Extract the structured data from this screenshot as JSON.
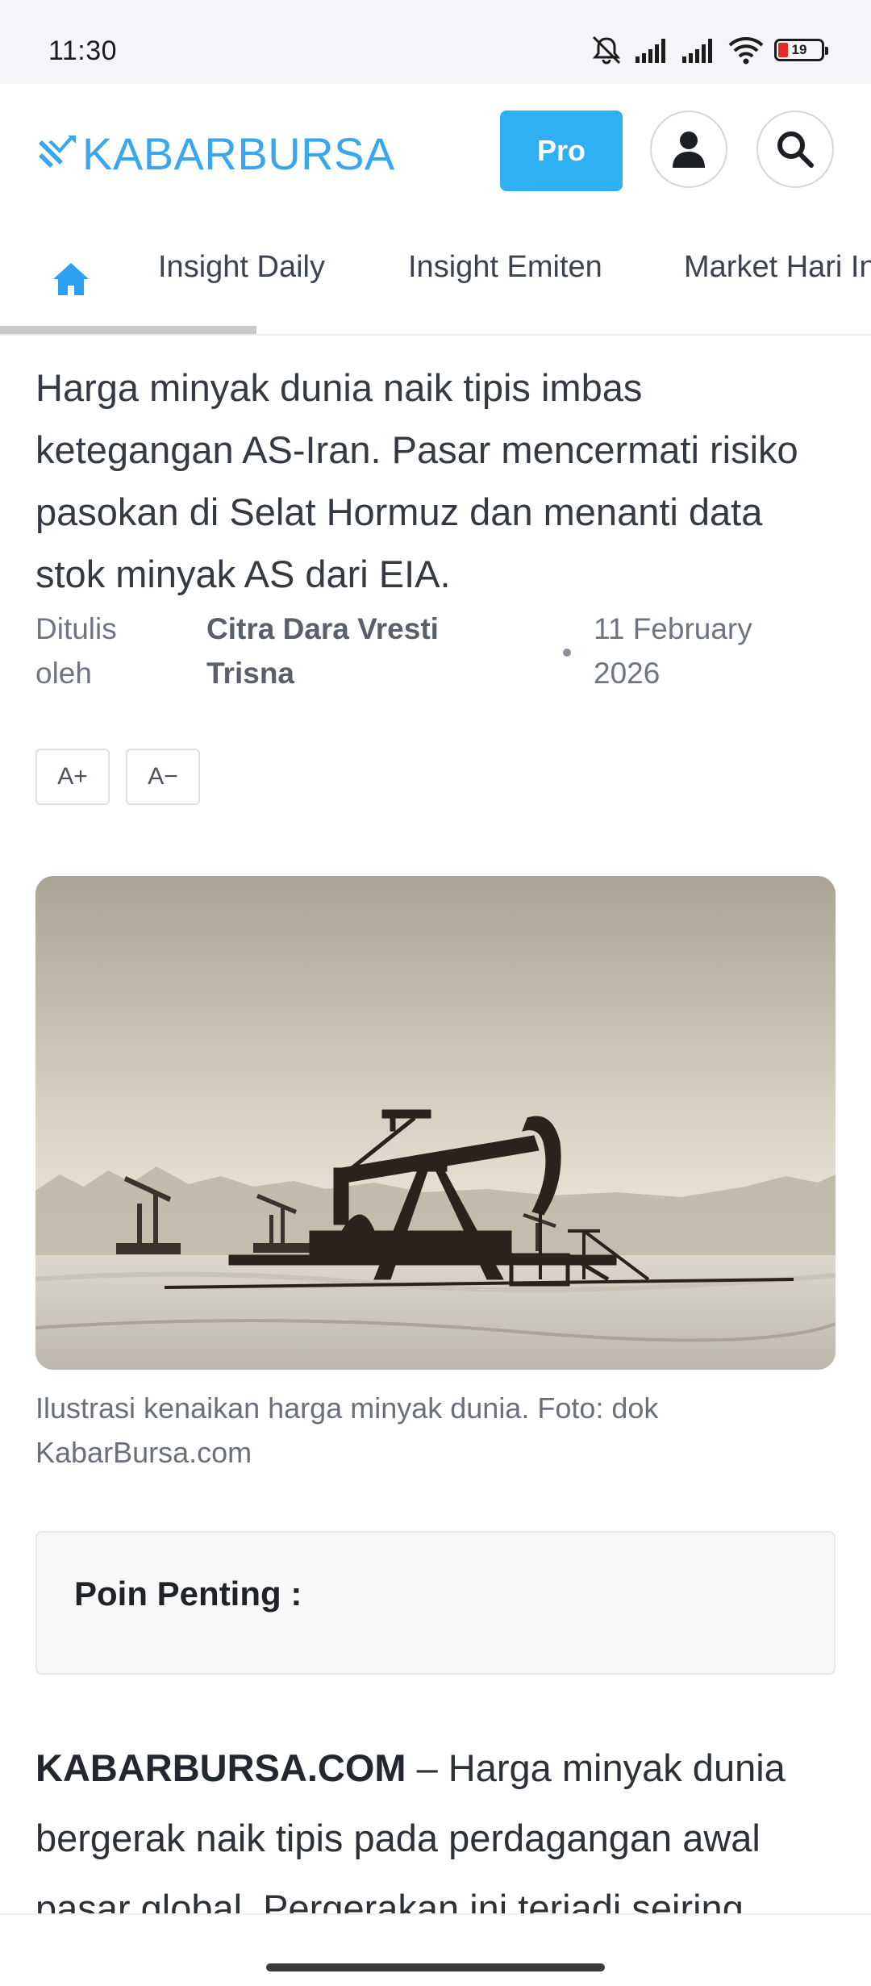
{
  "status_bar": {
    "time": "11:30",
    "battery": "19"
  },
  "header": {
    "logo_text": "KABARBURSA",
    "pro_label": "Pro"
  },
  "nav": {
    "tabs": [
      "Insight Daily",
      "Insight Emiten",
      "Market Hari Ini"
    ]
  },
  "article": {
    "lead": "Harga minyak dunia naik tipis imbas ketegangan AS-Iran. Pasar mencermati risiko pasokan di Selat Hormuz dan menanti data stok minyak AS dari EIA.",
    "byline_prefix": "Ditulis oleh",
    "author": "Citra Dara Vresti Trisna",
    "date": "11 February 2026",
    "font_increase": "A+",
    "font_decrease": "A−",
    "caption": "Ilustrasi kenaikan harga minyak dunia. Foto: dok KabarBursa.com",
    "key_points_label": "Poin Penting :",
    "body_brand": "KABARBURSA.COM",
    "body_text": " – Harga minyak dunia bergerak naik tipis pada perdagangan awal pasar global. Pergerakan ini terjadi seiring"
  }
}
